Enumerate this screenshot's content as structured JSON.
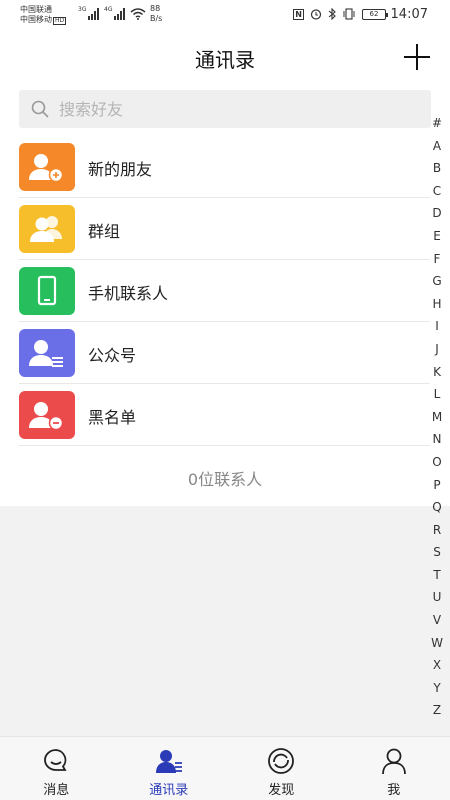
{
  "statusbar": {
    "carrier1": "中国联通",
    "carrier2": "中国移动",
    "hd": "HD",
    "sig1": "3G",
    "sig2": "4G",
    "netspeed_value": "88",
    "netspeed_unit": "B/s",
    "nfc": "N",
    "battery": "62",
    "time": "14:07"
  },
  "header": {
    "title": "通讯录"
  },
  "search": {
    "placeholder": "搜索好友",
    "value": ""
  },
  "contacts_menu": [
    {
      "label": "新的朋友",
      "icon": "add-friend-icon",
      "color": "#f5892a"
    },
    {
      "label": "群组",
      "icon": "group-icon",
      "color": "#f7be2c"
    },
    {
      "label": "手机联系人",
      "icon": "phone-icon",
      "color": "#27bf5e"
    },
    {
      "label": "公众号",
      "icon": "official-account-icon",
      "color": "#6a6fe8"
    },
    {
      "label": "黑名单",
      "icon": "blacklist-icon",
      "color": "#ec4b4b"
    }
  ],
  "contact_count": "0位联系人",
  "index": [
    "#",
    "A",
    "B",
    "C",
    "D",
    "E",
    "F",
    "G",
    "H",
    "I",
    "J",
    "K",
    "L",
    "M",
    "N",
    "O",
    "P",
    "Q",
    "R",
    "S",
    "T",
    "U",
    "V",
    "W",
    "X",
    "Y",
    "Z"
  ],
  "nav": [
    {
      "label": "消息",
      "icon": "message-icon"
    },
    {
      "label": "通讯录",
      "icon": "contacts-icon",
      "active": true
    },
    {
      "label": "发现",
      "icon": "discover-icon"
    },
    {
      "label": "我",
      "icon": "me-icon"
    }
  ],
  "colors": {
    "accent": "#2b3bb8"
  }
}
